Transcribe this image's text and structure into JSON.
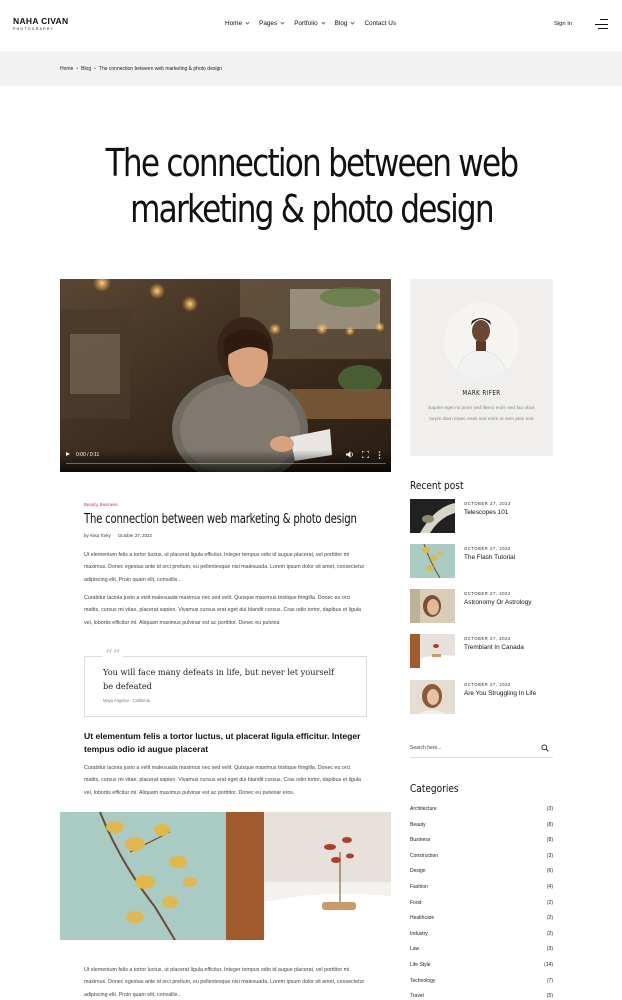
{
  "header": {
    "logo_main": "NAHA CIVAN",
    "logo_sub": "PHOTOGRAPHY",
    "nav": [
      {
        "label": "Home",
        "has_dropdown": true
      },
      {
        "label": "Pages",
        "has_dropdown": true
      },
      {
        "label": "Portfolio",
        "has_dropdown": true
      },
      {
        "label": "Blog",
        "has_dropdown": true
      },
      {
        "label": "Contact Us",
        "has_dropdown": false
      }
    ],
    "sign_in": "Sign In",
    "menu_icon": "hamburger-menu-icon"
  },
  "breadcrumb": {
    "items": [
      "Home",
      "Blog",
      "The connection between web marketing & photo design"
    ],
    "separator": "•"
  },
  "page": {
    "title_line1": "The connection between web",
    "title_line2": "marketing & photo design"
  },
  "video": {
    "time": "0:00 / 0:11",
    "icons": [
      "play-icon",
      "volume-icon",
      "fullscreen-icon",
      "more-options-icon"
    ]
  },
  "post": {
    "tags": "Beauty, Business",
    "title": "The connection between web marketing & photo design",
    "author_prefix": "by",
    "author": "Alisa Torky",
    "date": "October 27, 2022",
    "para1": "Ut elementum felis a tortor luctus, ut placerat ligula efficitur. Integer tempus odio id augue placerat, vel porttitor mi maximus. Donec egestas ante id orci pretium, eu pellentesque nisi malesuada. Lorem ipsum dolor sit amet, consectetur adipiscing elit. Proin quam elit, convallis..",
    "para2": "Curabitur lacinia justo a velit malesuada maximus nec sed velit. Quisque maximus tristique fringilla. Donec eu orci mattis, cursus mi vitae, placerat sapien. Vivamus cursus erat eget dui blandit cursus. Cras odio tortor, dapibus et ligula vel, lobortis efficitur mi. Aliquam maximus pulvinar est ac porttitor. Donec eu pulvina",
    "quote": "You will face many defeats in life, but never let yourself be defeated",
    "quote_cite": "Maya Angelou - California",
    "subheading": "Ut elementum felis a tortor luctus, ut placerat ligula efficitur. Integer tempus odio id augue placerat",
    "para3": "Curabitur lacinia justo a velit malesuada maximus nec sed velit. Quisque maximus tristique fringilla. Donec eu orci mattis, cursus mi vitae, placerat sapien. Vivamus cursus erat eget dui blandit cursus. Cras odio tortor, dapibus et ligula vel, lobortis efficitur mi. Aliquam maximus pulvinar est ac porttitor. Donec eu pulvinar eros.",
    "para4": "Ut elementum felis a tortor luctus, ut placerat ligula efficitur. Integer tempus odio id augue placerat, vel porttitor mi maximus. Donec egestas ante id orci pretium, eu pellentesque nisi malesuada. Lorem ipsum dolor sit amet, consectetur adipiscing elit. Proin quam elit, convallis.."
  },
  "author_card": {
    "name": "MARK RIFER",
    "bio": "Sapien eget mi proin sed libero enim sed fau obus turpis diam maec enas sed enim ut sem plac erat"
  },
  "recent": {
    "heading": "Recent post",
    "items": [
      {
        "date": "OCTOBER 27, 2022",
        "title": "Telescopes 101"
      },
      {
        "date": "OCTOBER 27, 2022",
        "title": "The Flash Tutorial"
      },
      {
        "date": "OCTOBER 27, 2022",
        "title": "Astronomy Or Astrology"
      },
      {
        "date": "OCTOBER 27, 2022",
        "title": "Tremblant In Canada"
      },
      {
        "date": "OCTOBER 27, 2022",
        "title": "Are You Struggling In Life"
      }
    ]
  },
  "search": {
    "placeholder": "Search here..."
  },
  "categories": {
    "heading": "Categories",
    "items": [
      {
        "name": "Architecture",
        "count": "(3)"
      },
      {
        "name": "Beauty",
        "count": "(8)"
      },
      {
        "name": "Business",
        "count": "(8)"
      },
      {
        "name": "Construction",
        "count": "(3)"
      },
      {
        "name": "Design",
        "count": "(6)"
      },
      {
        "name": "Fashion",
        "count": "(4)"
      },
      {
        "name": "Food",
        "count": "(2)"
      },
      {
        "name": "Healthcare",
        "count": "(2)"
      },
      {
        "name": "Industry",
        "count": "(2)"
      },
      {
        "name": "Law",
        "count": "(3)"
      },
      {
        "name": "Life Style",
        "count": "(14)"
      },
      {
        "name": "Technology",
        "count": "(7)"
      },
      {
        "name": "Travel",
        "count": "(5)"
      }
    ]
  },
  "colors": {
    "accent": "#e0245e",
    "band": "#f2f2f2",
    "card": "#f0efed"
  }
}
